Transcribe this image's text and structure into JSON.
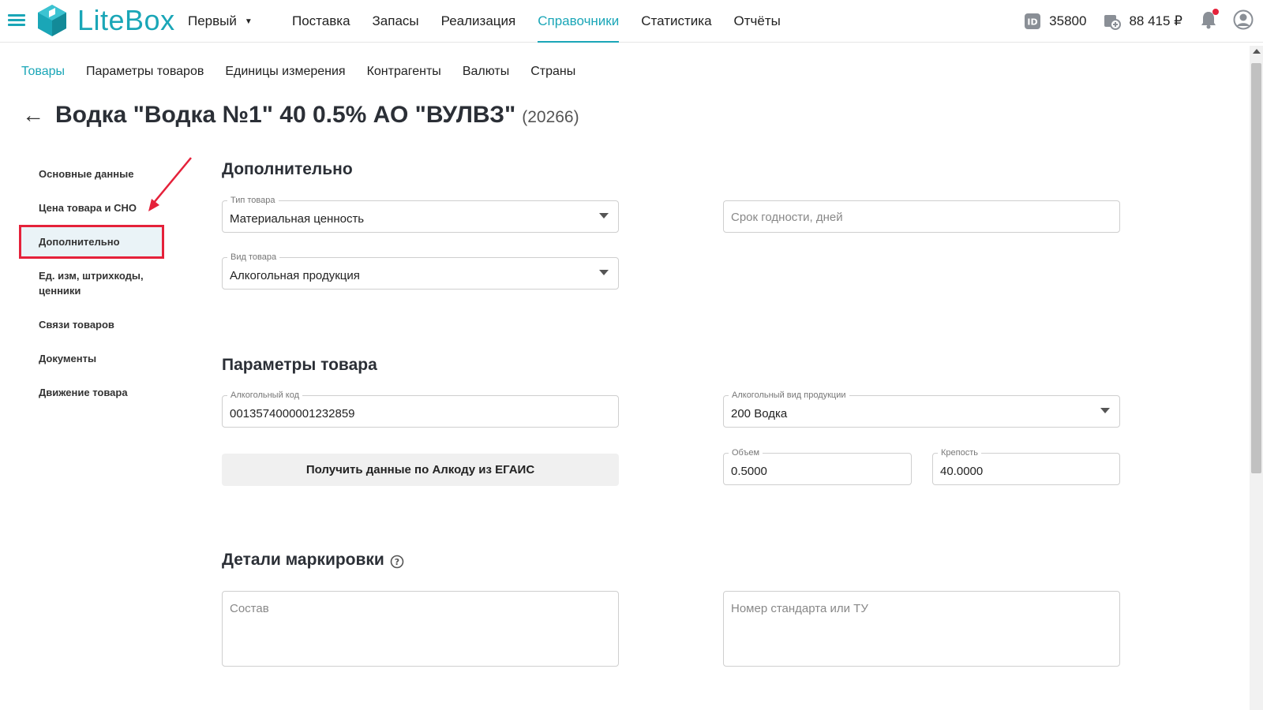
{
  "header": {
    "logo_text": "LiteBox",
    "store": "Первый",
    "nav": [
      {
        "label": "Поставка"
      },
      {
        "label": "Запасы"
      },
      {
        "label": "Реализация"
      },
      {
        "label": "Справочники",
        "active": true
      },
      {
        "label": "Статистика"
      },
      {
        "label": "Отчёты"
      }
    ],
    "id_value": "35800",
    "balance": "88 415 ₽",
    "accent_color": "#1aa6b7",
    "notification_color": "#e5213a"
  },
  "subnav": [
    {
      "label": "Товары",
      "active": true
    },
    {
      "label": "Параметры товаров"
    },
    {
      "label": "Единицы измерения"
    },
    {
      "label": "Контрагенты"
    },
    {
      "label": "Валюты"
    },
    {
      "label": "Страны"
    }
  ],
  "page": {
    "back_icon": "←",
    "title": "Водка \"Водка №1\" 40 0.5% АО \"ВУЛВЗ\"",
    "code": "(20266)"
  },
  "left_menu": [
    {
      "label": "Основные данные"
    },
    {
      "label": "Цена товара и СНО"
    },
    {
      "label": "Дополнительно",
      "active": true
    },
    {
      "label": "Ед. изм, штрихкоды, ценники"
    },
    {
      "label": "Связи товаров"
    },
    {
      "label": "Документы"
    },
    {
      "label": "Движение товара"
    }
  ],
  "section_additional": {
    "title": "Дополнительно",
    "product_type": {
      "label": "Тип товара",
      "value": "Материальная ценность"
    },
    "product_kind": {
      "label": "Вид товара",
      "value": "Алкогольная продукция"
    },
    "shelf_life": {
      "placeholder": "Срок годности, дней"
    }
  },
  "section_params": {
    "title": "Параметры товара",
    "alco_code": {
      "label": "Алкогольный код",
      "value": "0013574000001232859"
    },
    "alco_kind": {
      "label": "Алкогольный вид продукции",
      "value": "200 Водка"
    },
    "volume": {
      "label": "Объем",
      "value": "0.5000"
    },
    "strength": {
      "label": "Крепость",
      "value": "40.0000"
    },
    "egais_button": "Получить данные по Алкоду из ЕГАИС"
  },
  "section_marking": {
    "title": "Детали маркировки",
    "composition": {
      "placeholder": "Состав"
    },
    "standard": {
      "placeholder": "Номер стандарта или ТУ"
    }
  }
}
